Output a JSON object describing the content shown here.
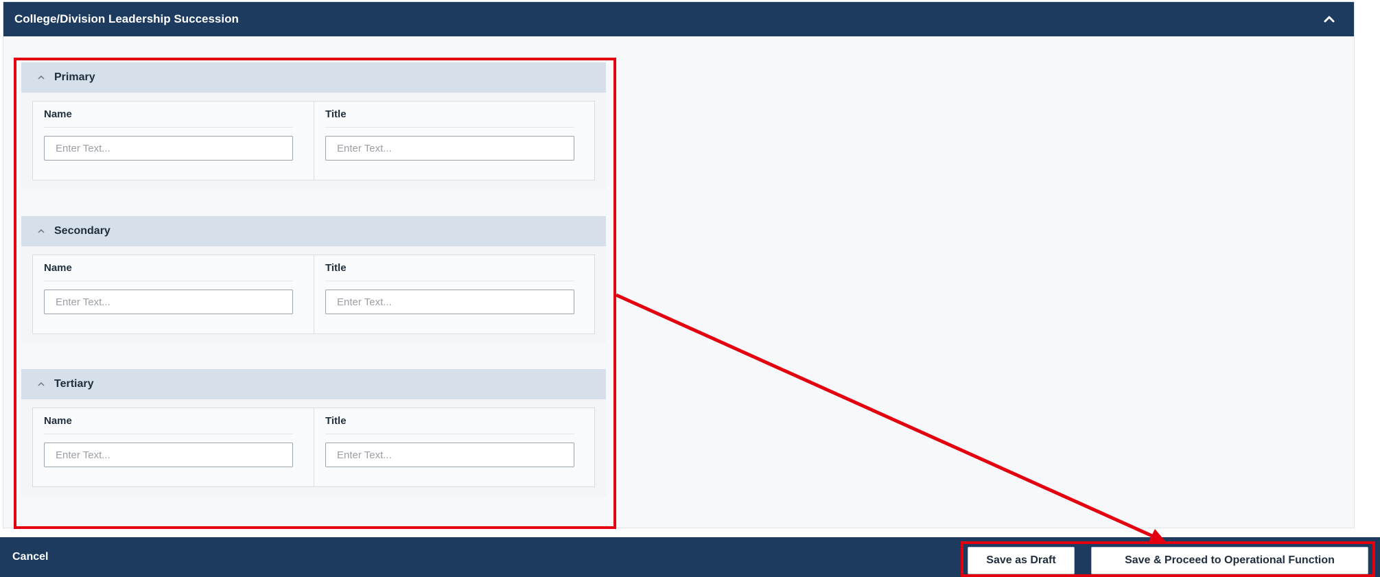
{
  "panel": {
    "title": "College/Division Leadership Succession"
  },
  "sections": [
    {
      "title": "Primary",
      "name_label": "Name",
      "title_label": "Title",
      "name_placeholder": "Enter Text...",
      "title_placeholder": "Enter Text..."
    },
    {
      "title": "Secondary",
      "name_label": "Name",
      "title_label": "Title",
      "name_placeholder": "Enter Text...",
      "title_placeholder": "Enter Text..."
    },
    {
      "title": "Tertiary",
      "name_label": "Name",
      "title_label": "Title",
      "name_placeholder": "Enter Text...",
      "title_placeholder": "Enter Text..."
    }
  ],
  "footer": {
    "cancel_label": "Cancel",
    "save_draft_label": "Save as Draft",
    "save_proceed_label": "Save & Proceed to Operational Function"
  },
  "icons": {
    "panel_collapse": "chevron-up-icon",
    "section_toggle": "chevron-up-icon"
  },
  "colors": {
    "header_bg": "#1d3a5f",
    "section_header_bg": "#d6e0ea",
    "annotation_red": "#e3000f"
  }
}
